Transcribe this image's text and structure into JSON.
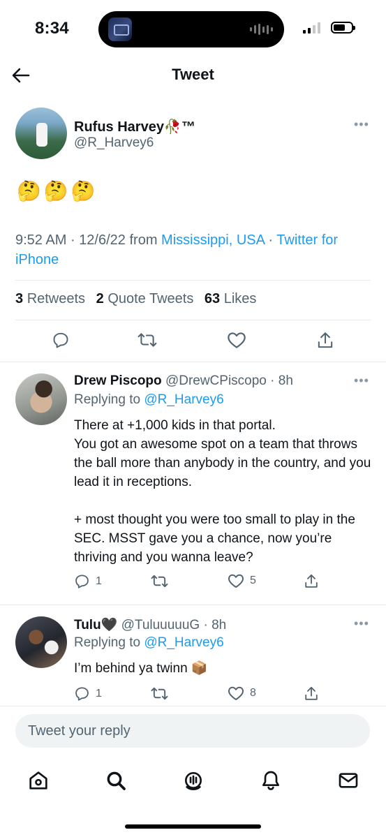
{
  "status_bar": {
    "time": "8:34"
  },
  "header": {
    "title": "Tweet"
  },
  "main_tweet": {
    "author_name": "Rufus Harvey🥀™",
    "author_handle": "@R_Harvey6",
    "text": "🤔🤔🤔",
    "time": "9:52 AM",
    "date": "12/6/22",
    "from_label": "from",
    "location": "Mississippi, USA",
    "separator": "·",
    "client": "Twitter for iPhone",
    "stats": {
      "retweets_count": "3",
      "retweets_label": "Retweets",
      "quotes_count": "2",
      "quotes_label": "Quote Tweets",
      "likes_count": "63",
      "likes_label": "Likes"
    }
  },
  "replies": [
    {
      "name": "Drew Piscopo",
      "handle": "@DrewCPiscopo",
      "time": "· 8h",
      "replying_label": "Replying to",
      "replying_to": "@R_Harvey6",
      "text": "There at +1,000 kids in that portal.\nYou got an awesome spot on a team that throws the ball more than anybody in the country, and you lead it in receptions.\n\n+ most thought you were too small to play in the SEC. MSST gave you a chance, now you’re thriving and you wanna leave?",
      "reply_count": "1",
      "like_count": "5"
    },
    {
      "name": "Tulu🖤",
      "handle": "@TuluuuuuG",
      "time": "· 8h",
      "replying_label": "Replying to",
      "replying_to": "@R_Harvey6",
      "text": "I’m behind ya twinn 📦",
      "reply_count": "1",
      "like_count": "8"
    }
  ],
  "compose": {
    "placeholder": "Tweet your reply"
  },
  "tabs": [
    "home-icon",
    "search-icon",
    "spaces-icon",
    "notifications-icon",
    "messages-icon"
  ],
  "colors": {
    "link": "#1d9bf0",
    "muted": "#536471",
    "text": "#0f1419"
  }
}
